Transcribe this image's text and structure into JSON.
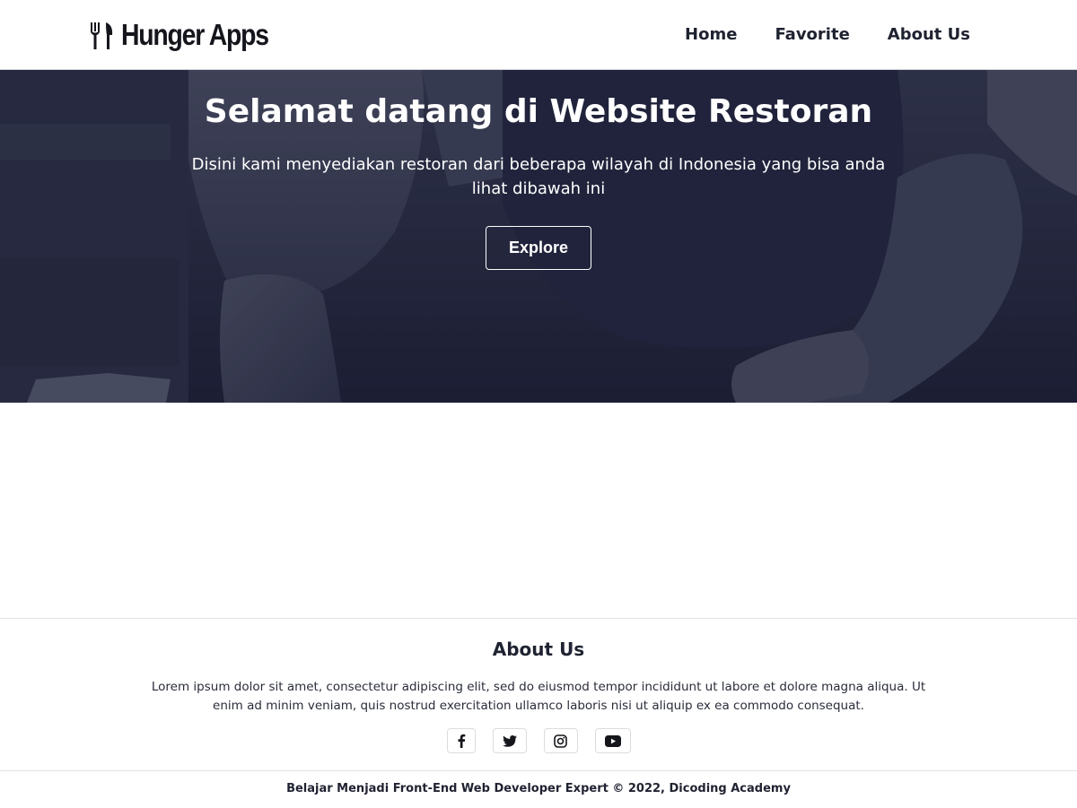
{
  "header": {
    "logo_text": "Hunger Apps",
    "logo_icon": "fork-and-knife-icon",
    "nav": [
      {
        "label": "Home"
      },
      {
        "label": "Favorite"
      },
      {
        "label": "About Us"
      }
    ]
  },
  "hero": {
    "title": "Selamat datang di Website Restoran",
    "subtitle": "Disini kami menyediakan restoran dari beberapa wilayah di Indonesia yang bisa anda lihat dibawah ini",
    "button_label": "Explore",
    "overlay_color": "#1d2036"
  },
  "footer": {
    "title": "About Us",
    "text": "Lorem ipsum dolor sit amet, consectetur adipiscing elit, sed do eiusmod tempor incididunt ut labore et dolore magna aliqua. Ut enim ad minim veniam, quis nostrud exercitation ullamco laboris nisi ut aliquip ex ea commodo consequat.",
    "socials": [
      {
        "icon": "facebook-icon"
      },
      {
        "icon": "twitter-icon"
      },
      {
        "icon": "instagram-icon"
      },
      {
        "icon": "youtube-icon"
      }
    ],
    "copyright": "Belajar Menjadi Front-End Web Developer Expert © 2022, Dicoding Academy"
  }
}
